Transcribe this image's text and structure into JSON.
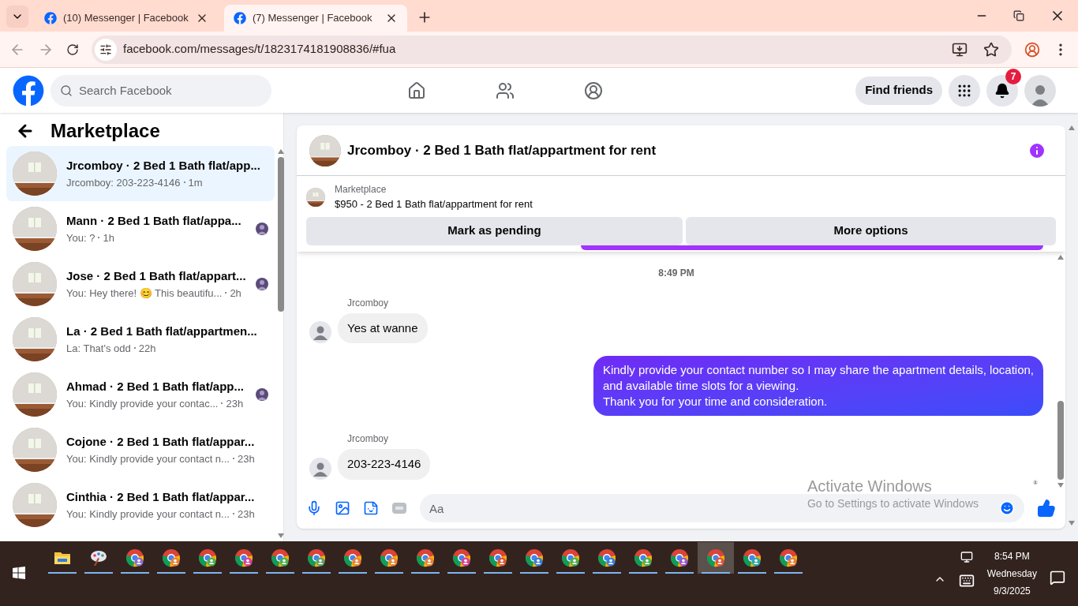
{
  "browser": {
    "tabs": [
      {
        "title": "(10) Messenger | Facebook",
        "selected": false
      },
      {
        "title": "(7) Messenger | Facebook",
        "selected": true
      }
    ],
    "url": "facebook.com/messages/t/1823174181908836/#fua"
  },
  "header": {
    "search": {
      "placeholder": "Search Facebook"
    },
    "find_friends": "Find friends",
    "notifications_badge": "7"
  },
  "sidebar": {
    "title": "Marketplace",
    "conversations": [
      {
        "title": "Jrcomboy · 2 Bed 1 Bath flat/app...",
        "preview": "Jrcomboy: 203-223-4146",
        "time": "1m",
        "selected": true,
        "seen": false
      },
      {
        "title": "Mann · 2 Bed 1 Bath flat/appa...",
        "preview": "You: ?",
        "time": "1h",
        "selected": false,
        "seen": true
      },
      {
        "title": "Jose · 2 Bed 1 Bath flat/appart...",
        "preview": "You: Hey there! 😊 This beautifu...",
        "time": "2h",
        "selected": false,
        "seen": true
      },
      {
        "title": "La · 2 Bed 1 Bath flat/appartmen...",
        "preview": "La: That's odd",
        "time": "22h",
        "selected": false,
        "seen": false
      },
      {
        "title": "Ahmad · 2 Bed 1 Bath flat/app...",
        "preview": "You: Kindly provide your contac...",
        "time": "23h",
        "selected": false,
        "seen": true
      },
      {
        "title": "Cojone · 2 Bed 1 Bath flat/appar...",
        "preview": "You: Kindly provide your contact n...",
        "time": "23h",
        "selected": false,
        "seen": false
      },
      {
        "title": "Cinthia · 2 Bed 1 Bath flat/appar...",
        "preview": "You: Kindly provide your contact n...",
        "time": "23h",
        "selected": false,
        "seen": false
      }
    ]
  },
  "chat": {
    "title": "Jrcomboy · 2 Bed 1 Bath flat/appartment for rent",
    "listing": {
      "label": "Marketplace",
      "description": "$950 - 2 Bed 1 Bath flat/appartment for rent"
    },
    "actions": [
      "Mark as pending",
      "More options"
    ],
    "messages": [
      {
        "kind": "time",
        "text": "8:49 PM"
      },
      {
        "kind": "incoming",
        "sender": "Jrcomboy",
        "text": "Yes at wanne"
      },
      {
        "kind": "outgoing",
        "text": "Kindly provide your contact number so I may share the apartment details, location,\nand available time slots for a viewing.\nThank you for your time and consideration."
      },
      {
        "kind": "incoming",
        "sender": "Jrcomboy",
        "text": "203-223-4146"
      }
    ],
    "composer": {
      "placeholder": "Aa"
    }
  },
  "os_notice": {
    "title": "Activate Windows",
    "subtitle": "Go to Settings to activate Windows"
  },
  "taskbar": {
    "apps": [
      {
        "kind": "folder",
        "selected": false
      },
      {
        "kind": "paint",
        "selected": false
      },
      {
        "kind": "chrome",
        "color": "#8a6fd0",
        "selected": false
      },
      {
        "kind": "chrome",
        "color": "#e8833a",
        "selected": false
      },
      {
        "kind": "chrome",
        "color": "#4caf50",
        "selected": false
      },
      {
        "kind": "chrome",
        "color": "#d64597",
        "selected": false
      },
      {
        "kind": "chrome",
        "color": "#4caf50",
        "selected": false
      },
      {
        "kind": "chrome",
        "color": "#5aa469",
        "selected": false
      },
      {
        "kind": "chrome",
        "color": "#e8833a",
        "selected": false
      },
      {
        "kind": "chrome",
        "color": "#e8833a",
        "selected": false
      },
      {
        "kind": "chrome",
        "color": "#e8833a",
        "selected": false
      },
      {
        "kind": "chrome",
        "color": "#d64597",
        "selected": false
      },
      {
        "kind": "chrome",
        "color": "#e0573a",
        "selected": false
      },
      {
        "kind": "chrome",
        "color": "#3b7fd9",
        "selected": false
      },
      {
        "kind": "chrome",
        "color": "#4caf50",
        "selected": false
      },
      {
        "kind": "chrome",
        "color": "#3b7fd9",
        "selected": false
      },
      {
        "kind": "chrome",
        "color": "#4caf50",
        "selected": false
      },
      {
        "kind": "chrome",
        "color": "#9b59d0",
        "selected": false
      },
      {
        "kind": "chrome",
        "color": "#e0573a",
        "selected": true
      },
      {
        "kind": "chrome",
        "color": "#2aa8a8",
        "selected": false
      },
      {
        "kind": "chrome",
        "color": "#e8833a",
        "selected": false
      }
    ],
    "time": "8:54 PM",
    "day": "Wednesday",
    "date": "9/3/2025"
  }
}
